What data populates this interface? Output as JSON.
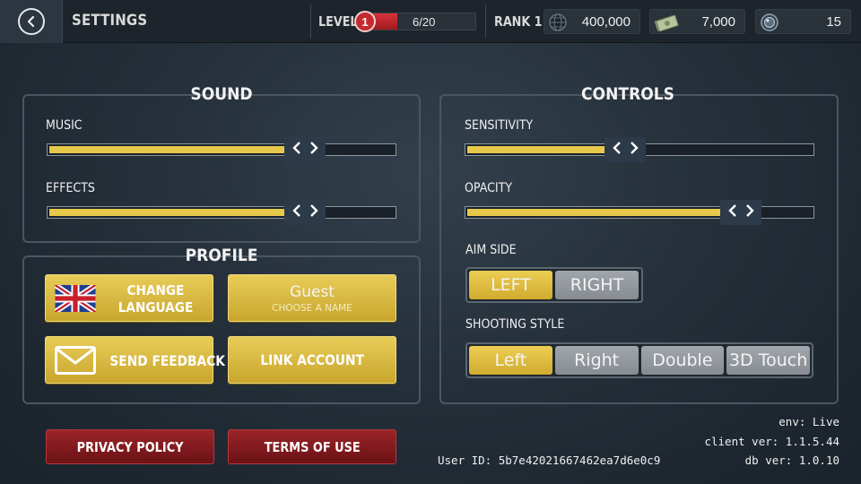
{
  "header": {
    "title": "SETTINGS",
    "level_label": "LEVEL",
    "level_number": "1",
    "level_progress_text": "6/20",
    "level_progress_fraction": 0.3,
    "rank_label": "RANK 1",
    "world_score": "400,000",
    "cash": "7,000",
    "gems": "15"
  },
  "sound": {
    "title": "SOUND",
    "music_label": "MUSIC",
    "music_level": 0.74,
    "effects_label": "EFFECTS",
    "effects_level": 0.74
  },
  "profile": {
    "title": "PROFILE",
    "change_language_line1": "CHANGE",
    "change_language_line2": "LANGUAGE",
    "guest_name": "Guest",
    "guest_sub": "CHOOSE A NAME",
    "send_feedback": "SEND FEEDBACK",
    "link_account": "LINK ACCOUNT"
  },
  "controls": {
    "title": "CONTROLS",
    "sensitivity_label": "SENSITIVITY",
    "sensitivity_level": 0.46,
    "opacity_label": "OPACITY",
    "opacity_level": 0.79,
    "aim_side_label": "AIM SIDE",
    "aim_side_options": [
      "LEFT",
      "RIGHT"
    ],
    "aim_side_selected": "LEFT",
    "shooting_style_label": "SHOOTING STYLE",
    "shooting_style_options": [
      "Left",
      "Right",
      "Double",
      "3D Touch"
    ],
    "shooting_style_selected": "Left"
  },
  "footer": {
    "privacy_policy": "PRIVACY POLICY",
    "terms_of_use": "TERMS OF USE",
    "user_id": "User ID: 5b7e42021667462ea7d6e0c9",
    "env": "env: Live",
    "client_ver": "client ver: 1.1.5.44",
    "db_ver": "db ver: 1.0.10"
  },
  "colors": {
    "accent_gold": "#e6c84a",
    "danger_red": "#9a2428",
    "panel_border": "#4a5661"
  },
  "icons": [
    "back-arrow-icon",
    "globe-icon",
    "cash-icon",
    "gem-icon",
    "uk-flag-icon",
    "envelope-icon",
    "chevron-left-icon",
    "chevron-right-icon"
  ]
}
